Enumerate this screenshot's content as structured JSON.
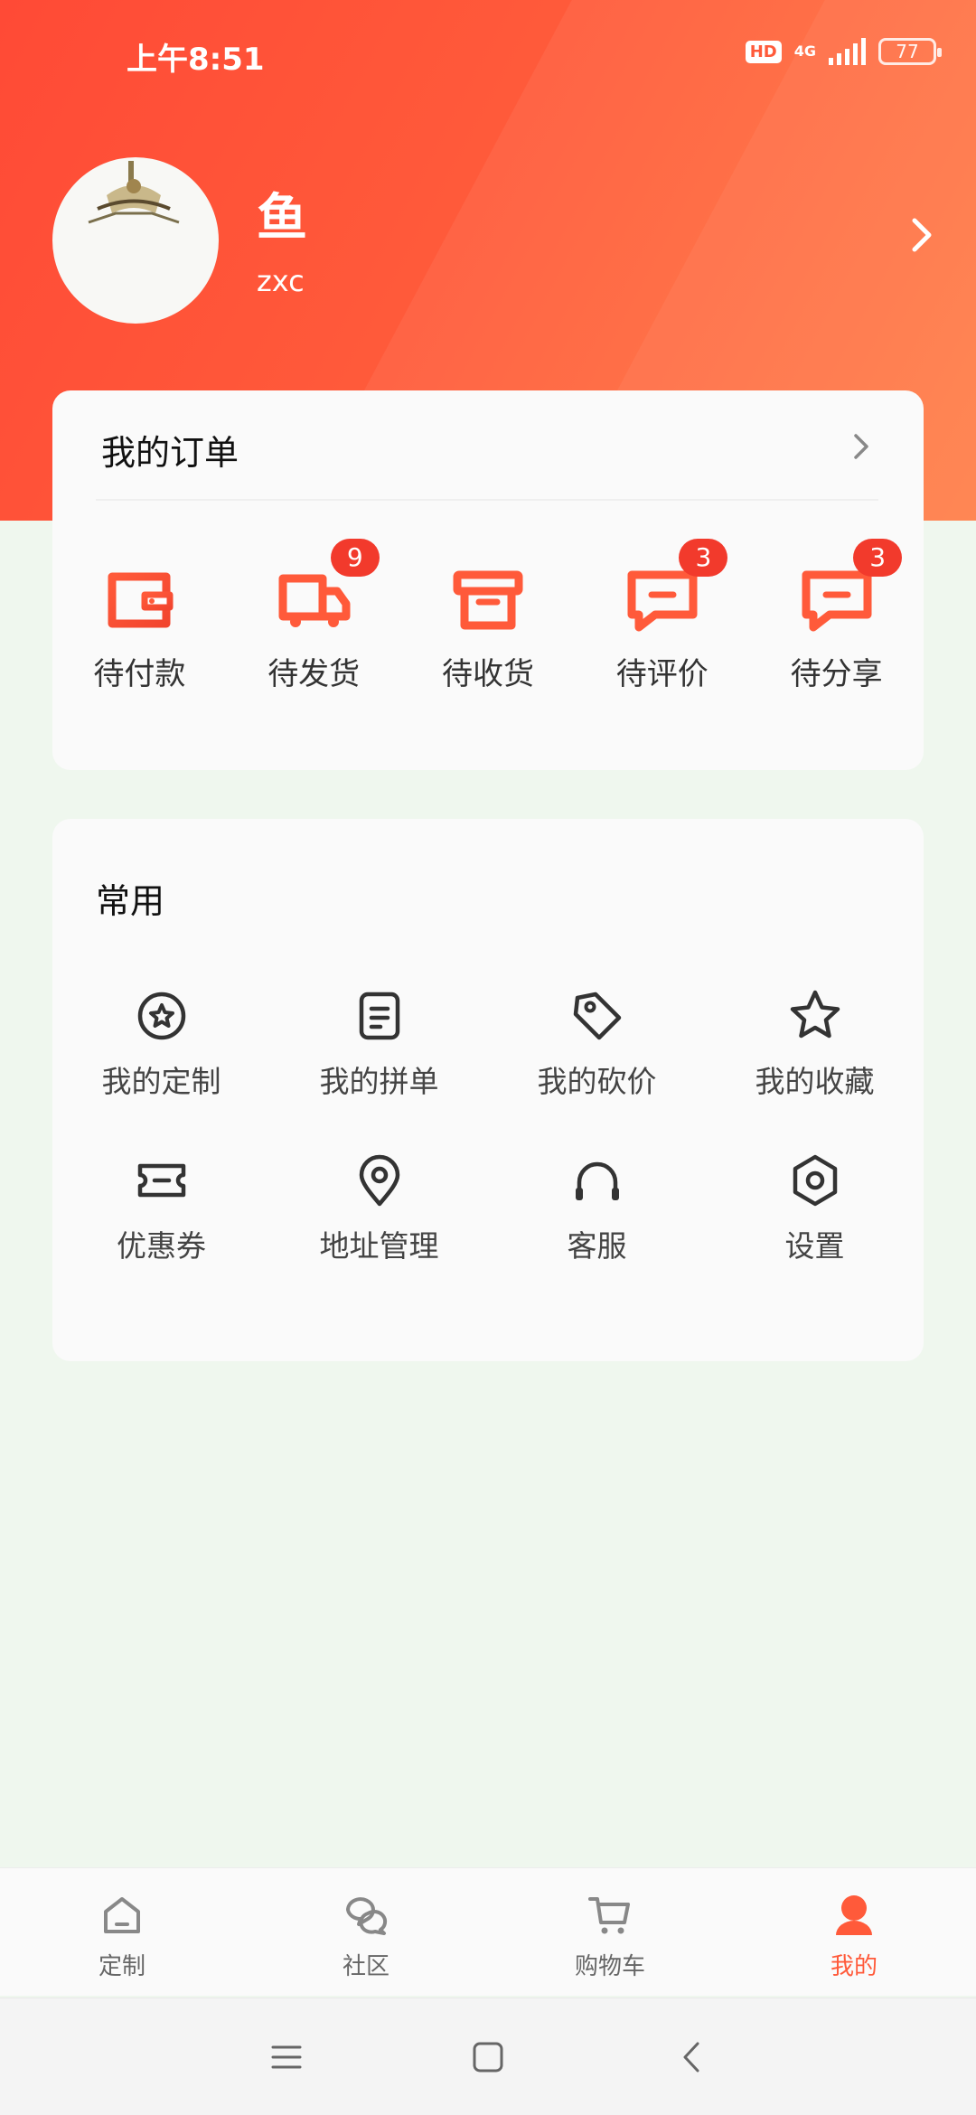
{
  "status_bar": {
    "time": "上午8:51",
    "hd": "HD",
    "network": "4G",
    "battery": "77"
  },
  "profile": {
    "nickname": "鱼",
    "username": "zxc"
  },
  "orders": {
    "title": "我的订单",
    "items": [
      {
        "label": "待付款",
        "icon": "wallet-icon",
        "badge": null
      },
      {
        "label": "待发货",
        "icon": "truck-icon",
        "badge": "9"
      },
      {
        "label": "待收货",
        "icon": "box-icon",
        "badge": null
      },
      {
        "label": "待评价",
        "icon": "comment-icon",
        "badge": "3"
      },
      {
        "label": "待分享",
        "icon": "share-comment-icon",
        "badge": "3"
      }
    ]
  },
  "common": {
    "title": "常用",
    "items": [
      {
        "label": "我的定制",
        "icon": "custom-badge-icon"
      },
      {
        "label": "我的拼单",
        "icon": "document-icon"
      },
      {
        "label": "我的砍价",
        "icon": "price-tag-icon"
      },
      {
        "label": "我的收藏",
        "icon": "star-icon"
      },
      {
        "label": "优惠券",
        "icon": "ticket-icon"
      },
      {
        "label": "地址管理",
        "icon": "location-pin-icon"
      },
      {
        "label": "客服",
        "icon": "headset-icon"
      },
      {
        "label": "设置",
        "icon": "settings-hex-icon"
      }
    ]
  },
  "tabbar": {
    "items": [
      {
        "label": "定制",
        "icon": "home-icon"
      },
      {
        "label": "社区",
        "icon": "chat-bubbles-icon"
      },
      {
        "label": "购物车",
        "icon": "cart-icon"
      },
      {
        "label": "我的",
        "icon": "user-icon"
      }
    ],
    "active_index": 3
  },
  "colors": {
    "accent": "#ff5a3a",
    "badge": "#f23a2c",
    "background": "#eff7ee"
  }
}
